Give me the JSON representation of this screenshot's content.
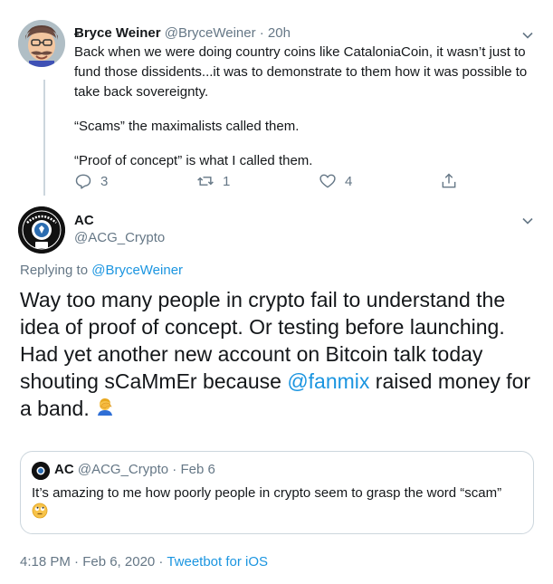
{
  "tweet1": {
    "name": "Ƀryce Weiner",
    "handle": "@BryceWeiner",
    "time": "· 20h",
    "paragraphs": [
      "Back when we were doing country coins like CataloniaCoin, it wasn’t just to fund those dissidents...it was to demonstrate to them how it was possible to take back sovereignty.",
      "“Scams” the maximalists called them.",
      "“Proof of concept” is what I called them."
    ],
    "replies": "3",
    "retweets": "1",
    "likes": "4"
  },
  "tweet2": {
    "name": "AC",
    "handle": "@ACG_Crypto",
    "replying_prefix": "Replying to ",
    "replying_to": "@BryceWeiner",
    "text_before": "Way too many people in crypto fail to understand the idea of proof of concept. Or testing before launching. Had yet another new account on Bitcoin talk today shouting sCaMmEr because ",
    "mention": "@fanmix",
    "text_after": " raised money for a band. "
  },
  "quote": {
    "name": "AC",
    "handle": "@ACG_Crypto",
    "time": "· Feb 6",
    "text": "It’s amazing to me how poorly people in crypto seem to grasp the word “scam”"
  },
  "footer": {
    "time": "4:18 PM · Feb 6, 2020 · ",
    "client": "Tweetbot for iOS"
  },
  "icons": {
    "reply": "reply-icon",
    "retweet": "retweet-icon",
    "like": "heart-icon",
    "share": "share-icon",
    "menu": "chevron-down-icon",
    "facepalm": "facepalm-emoji",
    "eyeroll": "eyeroll-emoji"
  },
  "colors": {
    "link": "#1b95e0",
    "muted": "#657786",
    "text": "#14171a",
    "border": "#ccd6dd"
  }
}
